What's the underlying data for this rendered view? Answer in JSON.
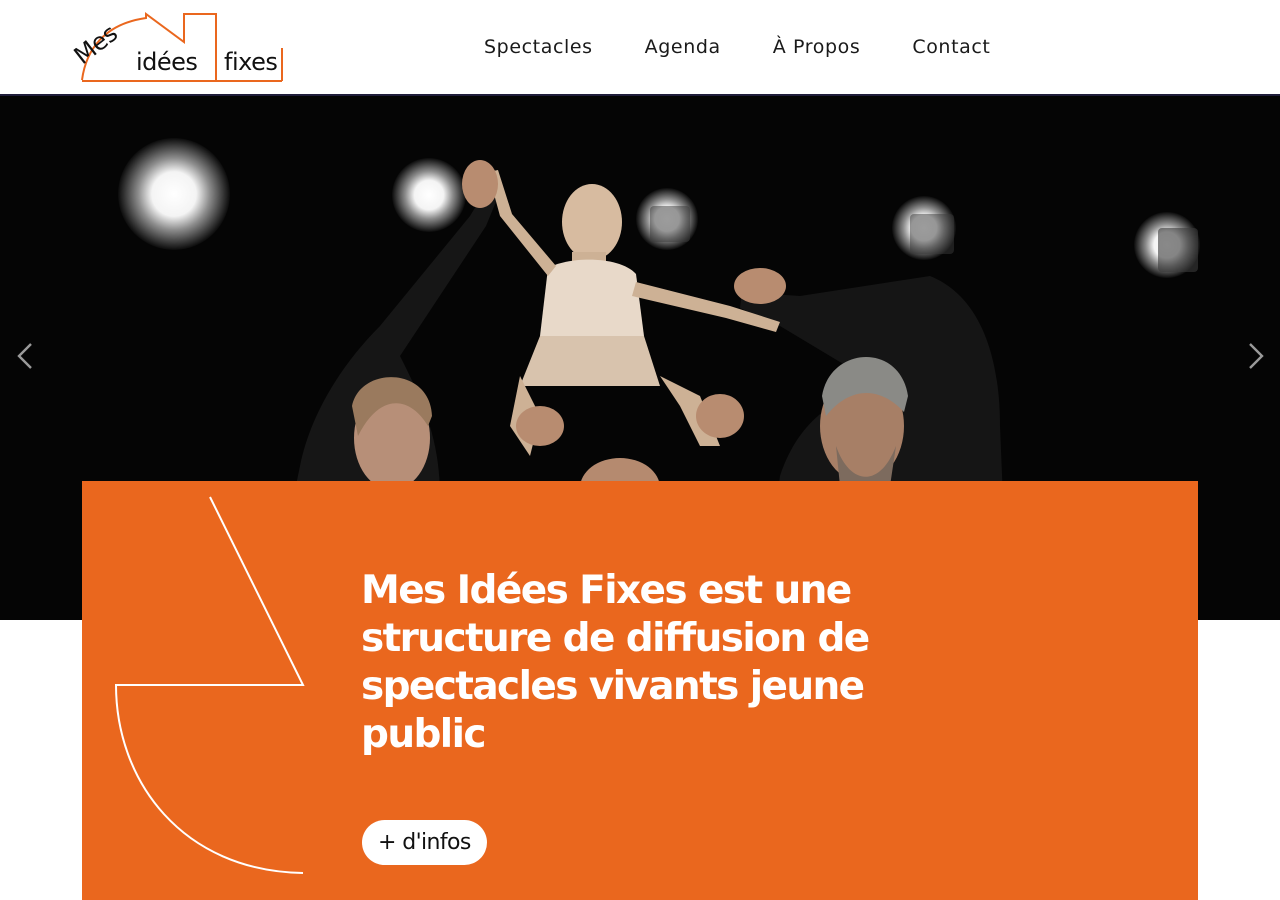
{
  "brand": {
    "logo_words": [
      "Mes",
      "idées",
      "fixes"
    ],
    "accent_color": "#ea671e",
    "dark_color": "#1f1d3a"
  },
  "nav": {
    "items": [
      {
        "label": "Spectacles"
      },
      {
        "label": "Agenda"
      },
      {
        "label": "À Propos"
      },
      {
        "label": "Contact"
      }
    ]
  },
  "hero": {
    "image": "puppet-theatre-photo",
    "prev_icon": "chevron-left-icon",
    "next_icon": "chevron-right-icon"
  },
  "intro": {
    "title": "Mes Idées Fixes est une structure de diffusion de spectacles vivants jeune public",
    "button_label": "+ d'infos"
  }
}
